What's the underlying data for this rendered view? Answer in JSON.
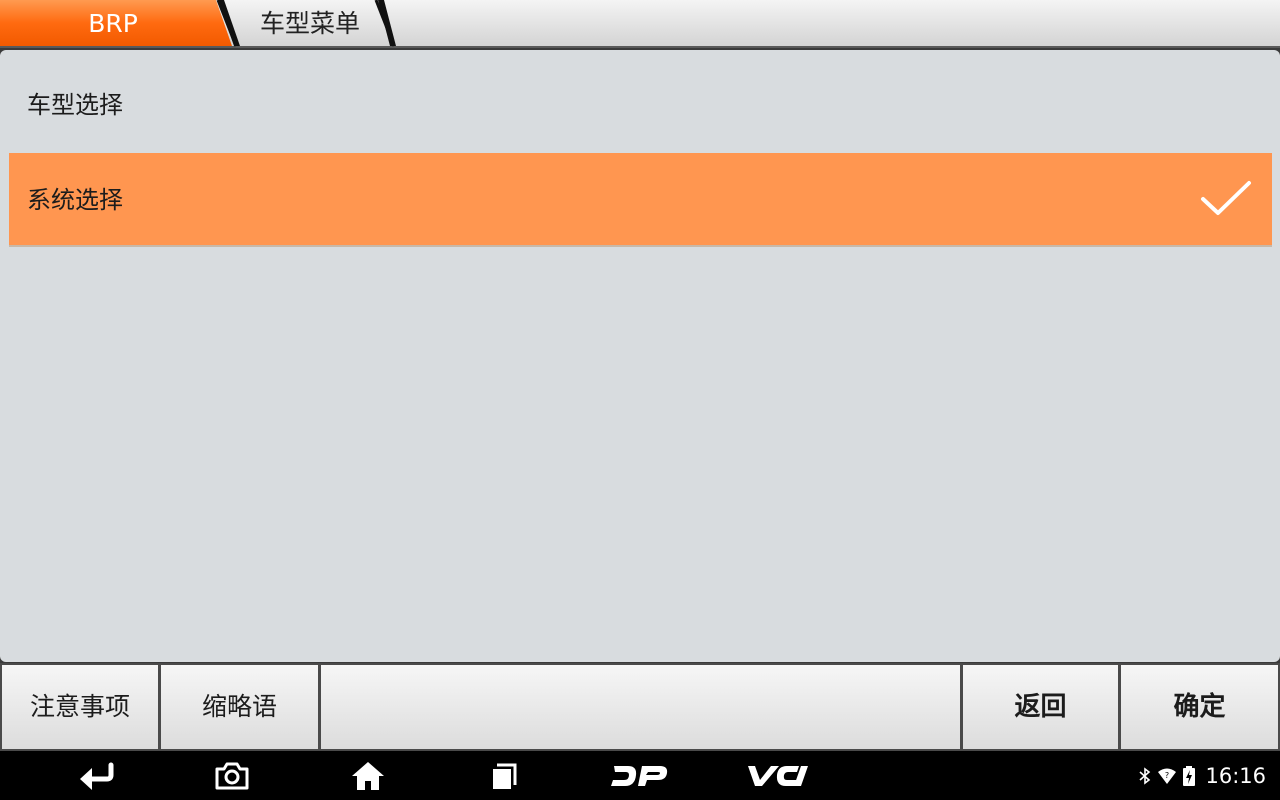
{
  "breadcrumb": {
    "root": "BRP",
    "current": "车型菜单"
  },
  "list": {
    "items": [
      {
        "label": "车型选择",
        "selected": false
      },
      {
        "label": "系统选择",
        "selected": true
      }
    ]
  },
  "buttons": {
    "notice": "注意事项",
    "abbreviations": "缩略语",
    "back": "返回",
    "confirm": "确定"
  },
  "navbar": {
    "dp_label": "DP",
    "vci_label": "VCI",
    "time": "16:16",
    "icons": [
      "back-icon",
      "camera-icon",
      "home-icon",
      "recent-apps-icon",
      "bluetooth-icon",
      "wifi-icon",
      "battery-icon"
    ]
  },
  "colors": {
    "accent": "#ff6a10",
    "selected_row": "#ff9650",
    "panel": "#d8dcdf"
  }
}
